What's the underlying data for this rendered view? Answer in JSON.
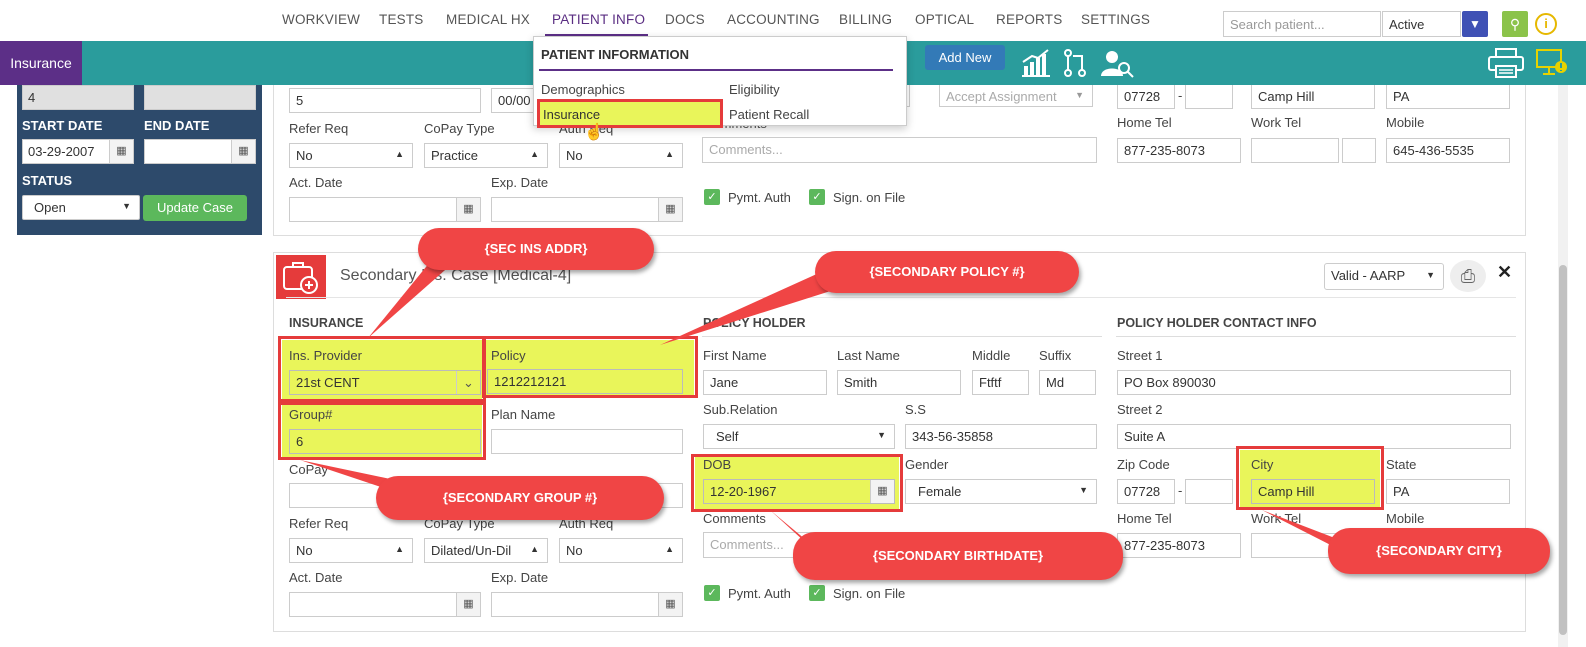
{
  "nav": {
    "items": [
      "WORKVIEW",
      "TESTS",
      "MEDICAL HX",
      "PATIENT INFO",
      "DOCS",
      "ACCOUNTING",
      "BILLING",
      "OPTICAL",
      "REPORTS",
      "SETTINGS"
    ],
    "search_placeholder": "Search patient...",
    "status_value": "Active"
  },
  "toolbar": {
    "tab": "Insurance",
    "add_new": "Add New"
  },
  "dropdown": {
    "title": "PATIENT INFORMATION",
    "items": [
      "Demographics",
      "Eligibility",
      "Insurance",
      "Patient Recall"
    ]
  },
  "leftpanel": {
    "top1": "4",
    "start_date_label": "START DATE",
    "end_date_label": "END DATE",
    "start_date": "03-29-2007",
    "status_label": "STATUS",
    "status_value": "Open",
    "update_btn": "Update Case"
  },
  "primary": {
    "policy_partial": "5",
    "date_partial": "00/00",
    "refer_req_label": "Refer Req",
    "copay_type_label": "CoPay Type",
    "auth_req_label": "Auth Req",
    "refer_req": "No",
    "copay_type": "Practice",
    "auth_req": "No",
    "act_date_label": "Act. Date",
    "exp_date_label": "Exp. Date",
    "accept_assignment": "Accept Assignment",
    "comments_label": "Comments",
    "comments_placeholder": "Comments...",
    "pymt_auth": "Pymt. Auth",
    "sign_on_file": "Sign. on File",
    "zip": "07728",
    "city": "Camp Hill",
    "state": "PA",
    "home_tel_label": "Home Tel",
    "work_tel_label": "Work Tel",
    "mobile_label": "Mobile",
    "home_tel": "877-235-8073",
    "mobile": "645-436-5535"
  },
  "secondary": {
    "title": "Secondary Ins. Case [Medical-4]",
    "valid": "Valid - AARP",
    "insurance_head": "INSURANCE",
    "policy_holder_head": "POLICY HOLDER",
    "contact_head": "POLICY HOLDER CONTACT INFO",
    "ins_provider_label": "Ins. Provider",
    "ins_provider": "21st CENT",
    "policy_label": "Policy",
    "policy": "1212212121",
    "group_label": "Group#",
    "group": "6",
    "plan_name_label": "Plan Name",
    "copay_label": "CoPay",
    "refer_req_label": "Refer Req",
    "copay_type_label": "CoPay Type",
    "auth_req_label": "Auth Req",
    "refer_req": "No",
    "copay_type": "Dilated/Un-Dil",
    "auth_req": "No",
    "act_date_label": "Act. Date",
    "exp_date_label": "Exp. Date",
    "first_name_label": "First Name",
    "last_name_label": "Last Name",
    "middle_label": "Middle",
    "suffix_label": "Suffix",
    "first_name": "Jane",
    "last_name": "Smith",
    "middle": "Ftftf",
    "suffix": "Md",
    "sub_relation_label": "Sub.Relation",
    "ss_label": "S.S",
    "sub_relation": "Self",
    "ss": "343-56-35858",
    "dob_label": "DOB",
    "dob": "12-20-1967",
    "gender_label": "Gender",
    "gender": "Female",
    "comments_label": "Comments",
    "comments_placeholder": "Comments...",
    "pymt_auth": "Pymt. Auth",
    "sign_on_file": "Sign. on File",
    "street1_label": "Street 1",
    "street1": "PO Box 890030",
    "street2_label": "Street 2",
    "street2": "Suite A",
    "zip_label": "Zip Code",
    "zip": "07728",
    "city_label": "City",
    "city": "Camp Hill",
    "state_label": "State",
    "state": "PA",
    "home_tel_label": "Home Tel",
    "work_tel_label": "Work Tel",
    "mobile_label": "Mobile",
    "home_tel": "877-235-8073"
  },
  "callouts": {
    "sec_ins_addr": "{SEC INS ADDR}",
    "sec_policy": "{SECONDARY POLICY #}",
    "sec_group": "{SECONDARY GROUP #}",
    "sec_birthdate": "{SECONDARY BIRTHDATE}",
    "sec_city": "{SECONDARY CITY}"
  },
  "colors": {
    "teal": "#2a9c9c",
    "purple": "#5c2f87",
    "highlight": "#e9f55a",
    "callout": "#f04545"
  }
}
